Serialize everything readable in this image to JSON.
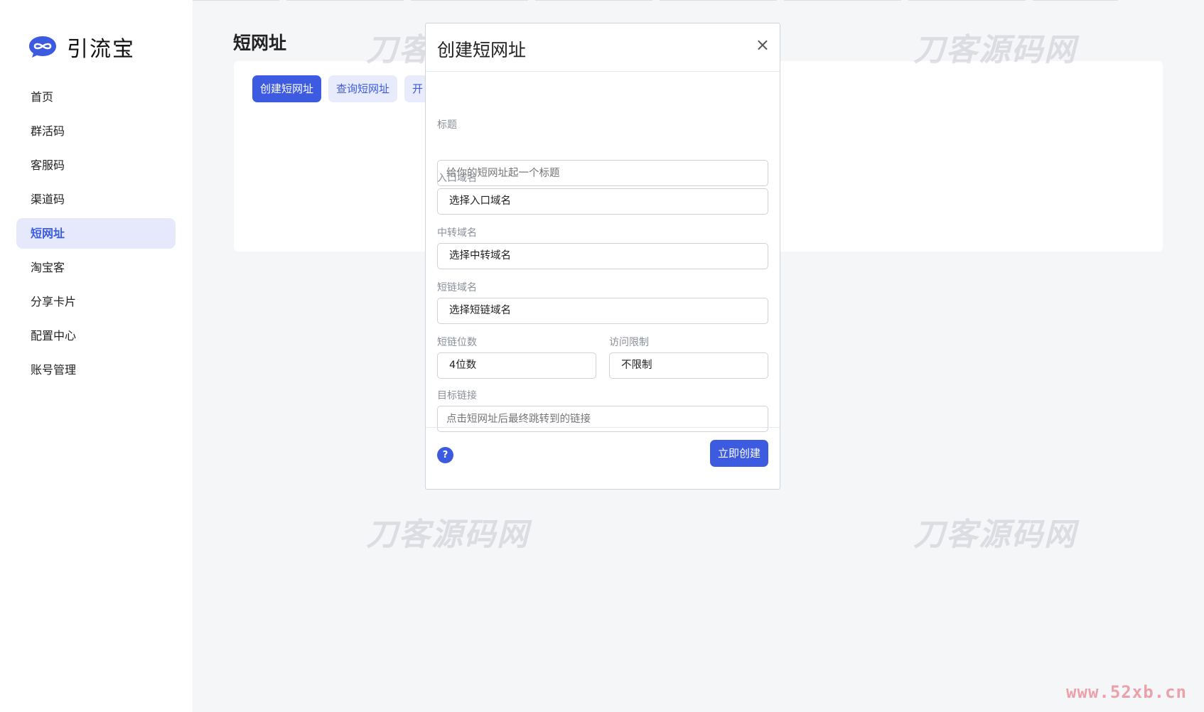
{
  "app": {
    "name": "引流宝"
  },
  "sidebar": {
    "items": [
      {
        "label": "首页",
        "active": false
      },
      {
        "label": "群活码",
        "active": false
      },
      {
        "label": "客服码",
        "active": false
      },
      {
        "label": "渠道码",
        "active": false
      },
      {
        "label": "短网址",
        "active": true
      },
      {
        "label": "淘宝客",
        "active": false
      },
      {
        "label": "分享卡片",
        "active": false
      },
      {
        "label": "配置中心",
        "active": false
      },
      {
        "label": "账号管理",
        "active": false
      }
    ]
  },
  "main": {
    "title": "短网址",
    "tabs": [
      {
        "label": "创建短网址",
        "active": true
      },
      {
        "label": "查询短网址",
        "active": false
      },
      {
        "label": "开",
        "active": false
      }
    ]
  },
  "modal": {
    "title": "创建短网址",
    "close_glyph": "×",
    "fields": {
      "title": {
        "label": "标题",
        "placeholder": "给你的短网址起一个标题"
      },
      "entry_domain": {
        "label": "入口域名",
        "value": "选择入口域名"
      },
      "relay_domain": {
        "label": "中转域名",
        "value": "选择中转域名"
      },
      "short_domain": {
        "label": "短链域名",
        "value": "选择短链域名"
      },
      "short_length": {
        "label": "短链位数",
        "value": "4位数"
      },
      "access_limit": {
        "label": "访问限制",
        "value": "不限制"
      },
      "target_url": {
        "label": "目标链接",
        "placeholder": "点击短网址后最终跳转到的链接"
      }
    },
    "help_glyph": "?",
    "submit_label": "立即创建"
  },
  "watermarks": {
    "text": "刀客源码网",
    "site": "www.52xb.cn"
  },
  "colors": {
    "accent": "#3c5be0",
    "accent_light": "#e5e9fb",
    "background": "#f5f6f8"
  },
  "icons": {
    "logo": "double-loop-chat-icon",
    "close": "close-icon",
    "help": "question-icon"
  }
}
